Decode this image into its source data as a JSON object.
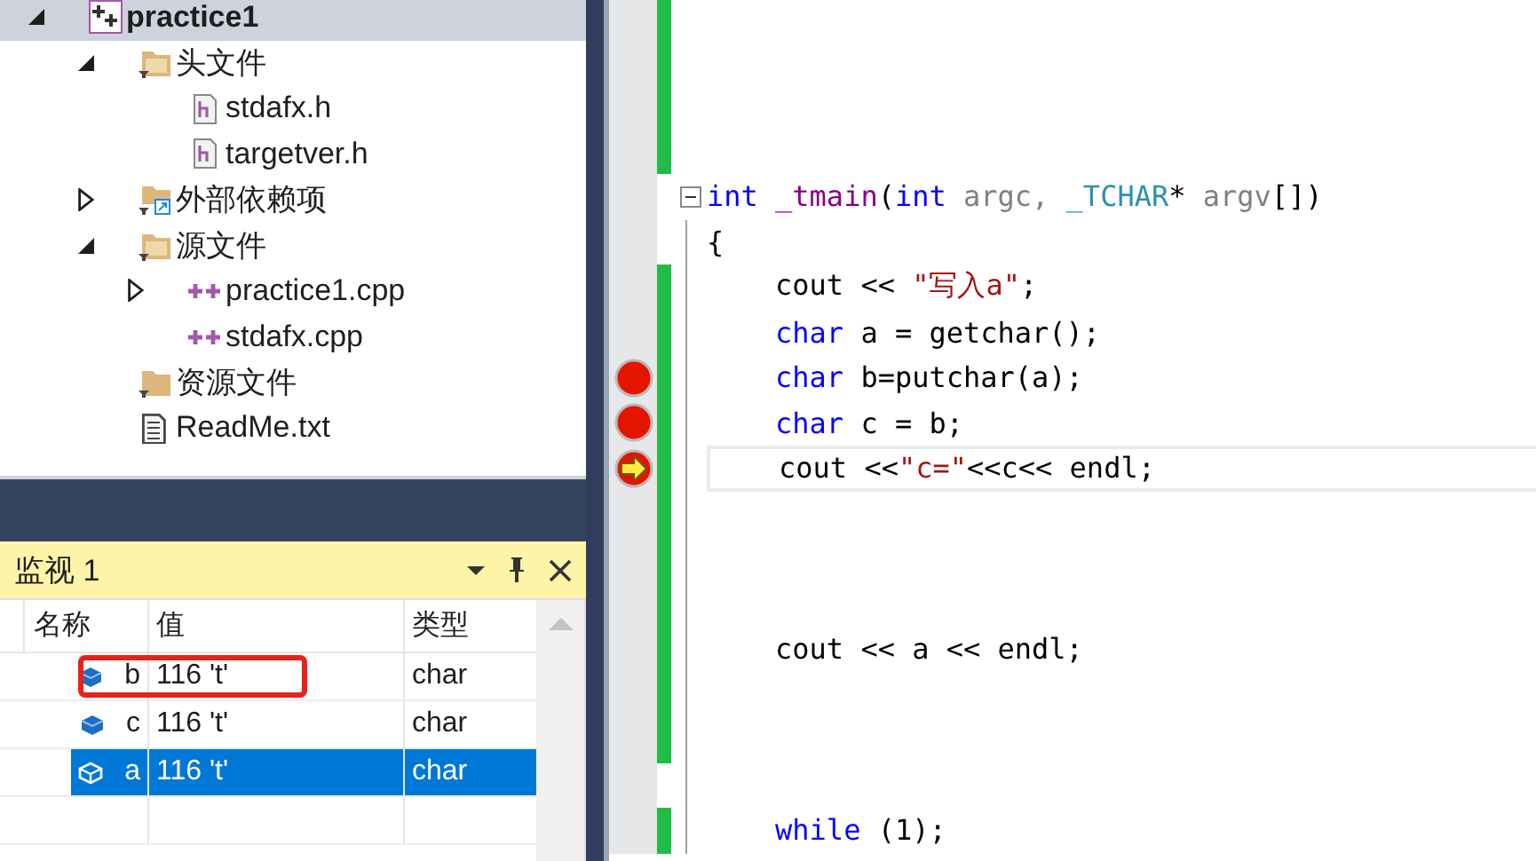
{
  "solution_explorer": {
    "tree": [
      {
        "label": "practice1",
        "kind": "project",
        "expanded": true,
        "selected": true,
        "children": [
          {
            "label": "头文件",
            "kind": "filter",
            "expanded": true,
            "selected": false,
            "children": [
              {
                "label": "stdafx.h",
                "kind": "header",
                "selected": false
              },
              {
                "label": "targetver.h",
                "kind": "header",
                "selected": false
              }
            ]
          },
          {
            "label": "外部依赖项",
            "kind": "references",
            "expanded": false,
            "selected": false
          },
          {
            "label": "源文件",
            "kind": "filter",
            "expanded": true,
            "selected": false,
            "children": [
              {
                "label": "practice1.cpp",
                "kind": "cpp",
                "expanded": false,
                "selected": false
              },
              {
                "label": "stdafx.cpp",
                "kind": "cpp",
                "selected": false
              }
            ]
          },
          {
            "label": "资源文件",
            "kind": "folder",
            "selected": false
          },
          {
            "label": "ReadMe.txt",
            "kind": "text",
            "selected": false
          }
        ]
      }
    ]
  },
  "watch": {
    "title": "监视 1",
    "columns": [
      "名称",
      "值",
      "类型"
    ],
    "rows": [
      {
        "name": "b",
        "value": "116 't'",
        "type": "char",
        "selected": false,
        "annotated": true
      },
      {
        "name": "c",
        "value": "116 't'",
        "type": "char",
        "selected": false,
        "annotated": false
      },
      {
        "name": "a",
        "value": "116 't'",
        "type": "char",
        "selected": true,
        "annotated": false
      }
    ]
  },
  "editor": {
    "lines": [
      {
        "changed": true,
        "breakpoint": false,
        "current": false
      },
      {
        "changed": true,
        "breakpoint": false,
        "current": false
      },
      {
        "changed": true,
        "breakpoint": false,
        "current": false
      },
      {
        "changed": true,
        "breakpoint": false,
        "current": false
      },
      {
        "changed": false,
        "breakpoint": false,
        "current": false,
        "collapsible": true,
        "tokens": [
          {
            "text": "int ",
            "kind": "keyword"
          },
          {
            "text": "_tmain",
            "kind": "function"
          },
          {
            "text": "(",
            "kind": "plain"
          },
          {
            "text": "int ",
            "kind": "keyword"
          },
          {
            "text": "argc, ",
            "kind": "param"
          },
          {
            "text": "_TCHAR",
            "kind": "type"
          },
          {
            "text": "* ",
            "kind": "plain"
          },
          {
            "text": "argv",
            "kind": "param"
          },
          {
            "text": "[])",
            "kind": "plain"
          }
        ]
      },
      {
        "changed": false,
        "breakpoint": false,
        "current": false,
        "tokens": [
          {
            "text": "{",
            "kind": "plain"
          }
        ]
      },
      {
        "changed": true,
        "breakpoint": false,
        "current": false,
        "indent": true,
        "tokens": [
          {
            "text": "cout << ",
            "kind": "plain"
          },
          {
            "text": "\"写入a\"",
            "kind": "string"
          },
          {
            "text": ";",
            "kind": "plain"
          }
        ]
      },
      {
        "changed": true,
        "breakpoint": false,
        "current": false,
        "indent": true,
        "tokens": [
          {
            "text": "char",
            "kind": "keyword"
          },
          {
            "text": " a = getchar();",
            "kind": "plain"
          }
        ]
      },
      {
        "changed": true,
        "breakpoint": true,
        "current": false,
        "indent": true,
        "tokens": [
          {
            "text": "char",
            "kind": "keyword"
          },
          {
            "text": " b=putchar(a);",
            "kind": "plain"
          }
        ]
      },
      {
        "changed": true,
        "breakpoint": true,
        "current": false,
        "indent": true,
        "tokens": [
          {
            "text": "char",
            "kind": "keyword"
          },
          {
            "text": " c = b;",
            "kind": "plain"
          }
        ]
      },
      {
        "changed": true,
        "breakpoint": true,
        "current": true,
        "indent": true,
        "tokens": [
          {
            "text": "cout <<",
            "kind": "plain"
          },
          {
            "text": "\"c=\"",
            "kind": "string"
          },
          {
            "text": "<<c<< endl;",
            "kind": "plain"
          }
        ]
      },
      {
        "changed": true,
        "breakpoint": false,
        "current": false
      },
      {
        "changed": true,
        "breakpoint": false,
        "current": false
      },
      {
        "changed": true,
        "breakpoint": false,
        "current": false
      },
      {
        "changed": true,
        "breakpoint": false,
        "current": false,
        "indent": true,
        "tokens": [
          {
            "text": "cout << a << endl;",
            "kind": "plain"
          }
        ]
      },
      {
        "changed": true,
        "breakpoint": false,
        "current": false
      },
      {
        "changed": true,
        "breakpoint": false,
        "current": false
      },
      {
        "changed": false,
        "breakpoint": false,
        "current": false
      },
      {
        "changed": true,
        "breakpoint": false,
        "current": false,
        "indent": true,
        "tokens": [
          {
            "text": "while",
            "kind": "keyword"
          },
          {
            "text": " (1);",
            "kind": "plain"
          }
        ]
      }
    ]
  }
}
